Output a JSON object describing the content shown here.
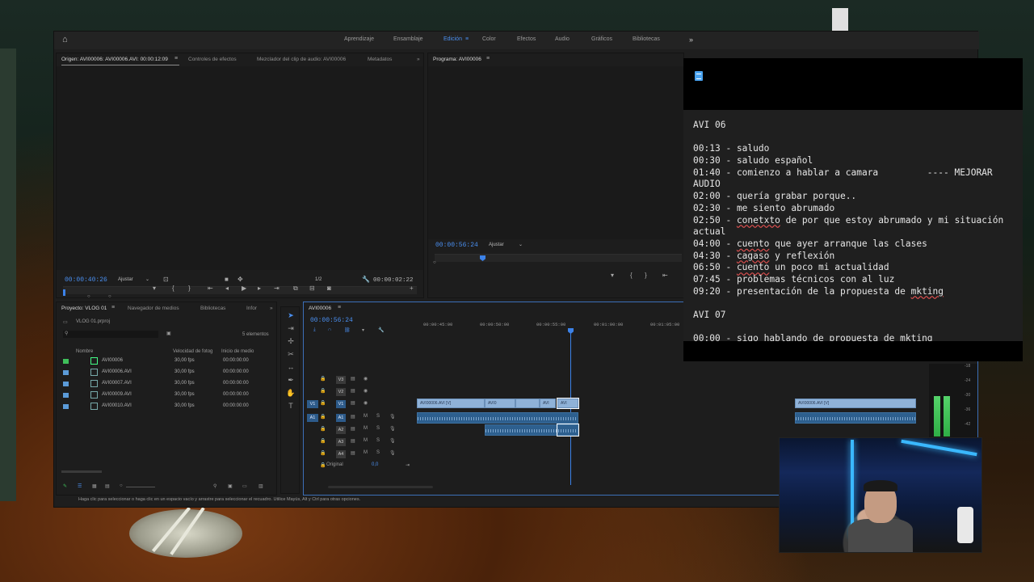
{
  "workspace_tabs": [
    {
      "label": "Aprendizaje",
      "active": false
    },
    {
      "label": "Ensamblaje",
      "active": false
    },
    {
      "label": "Edición",
      "active": true
    },
    {
      "label": "Color",
      "active": false
    },
    {
      "label": "Efectos",
      "active": false
    },
    {
      "label": "Audio",
      "active": false
    },
    {
      "label": "Gráficos",
      "active": false
    },
    {
      "label": "Bibliotecas",
      "active": false
    }
  ],
  "source_panel": {
    "tabs": [
      "Origen: AVI00006: AVI00006.AVI: 00:00:12:09",
      "Controles de efectos",
      "Mezclador del clip de audio: AVI00006",
      "Metadatos"
    ],
    "timecode": "00:00:40:26",
    "fit": "Ajustar",
    "resolution": "1/2",
    "duration": "00:00:02:22"
  },
  "program_panel": {
    "title": "Programa: AVI00006",
    "timecode": "00:00:56:24",
    "fit": "Ajustar"
  },
  "project_panel": {
    "tabs": [
      "Proyecto: VLOG 01",
      "Navegador de medios",
      "Bibliotecas",
      "Infor"
    ],
    "file": "VLOG 01.prproj",
    "count": "5 elementos",
    "columns": [
      "Nombre",
      "Velocidad de fotog",
      "Inicio de medio"
    ],
    "rows": [
      {
        "name": "AVI00006",
        "fps": "30,00 fps",
        "start": "00:00:00:00",
        "color": "#3fbf5a"
      },
      {
        "name": "AVI00006.AVI",
        "fps": "30,00 fps",
        "start": "00:00:00:00",
        "color": "#5b9bd8"
      },
      {
        "name": "AVI00007.AVI",
        "fps": "30,00 fps",
        "start": "00:00:00:00",
        "color": "#5b9bd8"
      },
      {
        "name": "AVI00009.AVI",
        "fps": "30,00 fps",
        "start": "00:00:00:00",
        "color": "#5b9bd8"
      },
      {
        "name": "AVI00010.AVI",
        "fps": "30,00 fps",
        "start": "00:00:00:00",
        "color": "#5b9bd8"
      }
    ]
  },
  "timeline": {
    "sequence": "AVI00006",
    "timecode": "00:00:56:24",
    "ruler": [
      "00:00:45:00",
      "00:00:50:00",
      "00:00:55:00",
      "00:01:00:00",
      "00:01:05:00"
    ],
    "video_tracks": [
      "V3",
      "V2",
      "V1"
    ],
    "audio_tracks": [
      "A1",
      "A2",
      "A3",
      "A4"
    ],
    "src_video": "V1",
    "src_audio": "A1",
    "track_buttons": {
      "mute": "M",
      "solo": "S"
    },
    "original_label": "Original",
    "original_value": "0,0",
    "clips": [
      {
        "label": "AVI00006.AVI [V]"
      },
      {
        "label": "AVI0"
      },
      {
        "label": "AVI"
      },
      {
        "label": "AVI"
      },
      {
        "label": "AVI00006.AVI [V]"
      }
    ]
  },
  "meter_scale": [
    "-18",
    "-24",
    "-30",
    "-36",
    "-42"
  ],
  "status_bar": "Haga clic para seleccionar o haga clic en un espacio vacío y arrastre para seleccionar el recuadro. Utilice Mayús, Alt y Ctrl para otras opciones.",
  "notes": {
    "lines": [
      "AVI 06",
      "",
      "00:13 - saludo",
      "00:30 - saludo español",
      "01:40 - comienzo a hablar a camara         ---- MEJORAR",
      "AUDIO",
      "02:00 - quería grabar porque..",
      "02:30 - me siento abrumado",
      "02:50 - conetxto de por que estoy abrumado y mi situación",
      "actual",
      "04:00 - cuento que ayer arranque las clases",
      "04:30 - cagaso y reflexión",
      "06:50 - cuento un poco mi actualidad",
      "07:45 - problemas técnicos con al luz",
      "09:20 - presentación de la propuesta de mkting",
      "",
      "AVI 07",
      "",
      "00:00 - sigo hablando de propuesta de mkting"
    ],
    "misspelled": [
      "conetxto",
      "cagaso",
      "cuento",
      "mkting"
    ]
  },
  "icons": {
    "home": "home-icon",
    "notes": "notepad-icon"
  }
}
